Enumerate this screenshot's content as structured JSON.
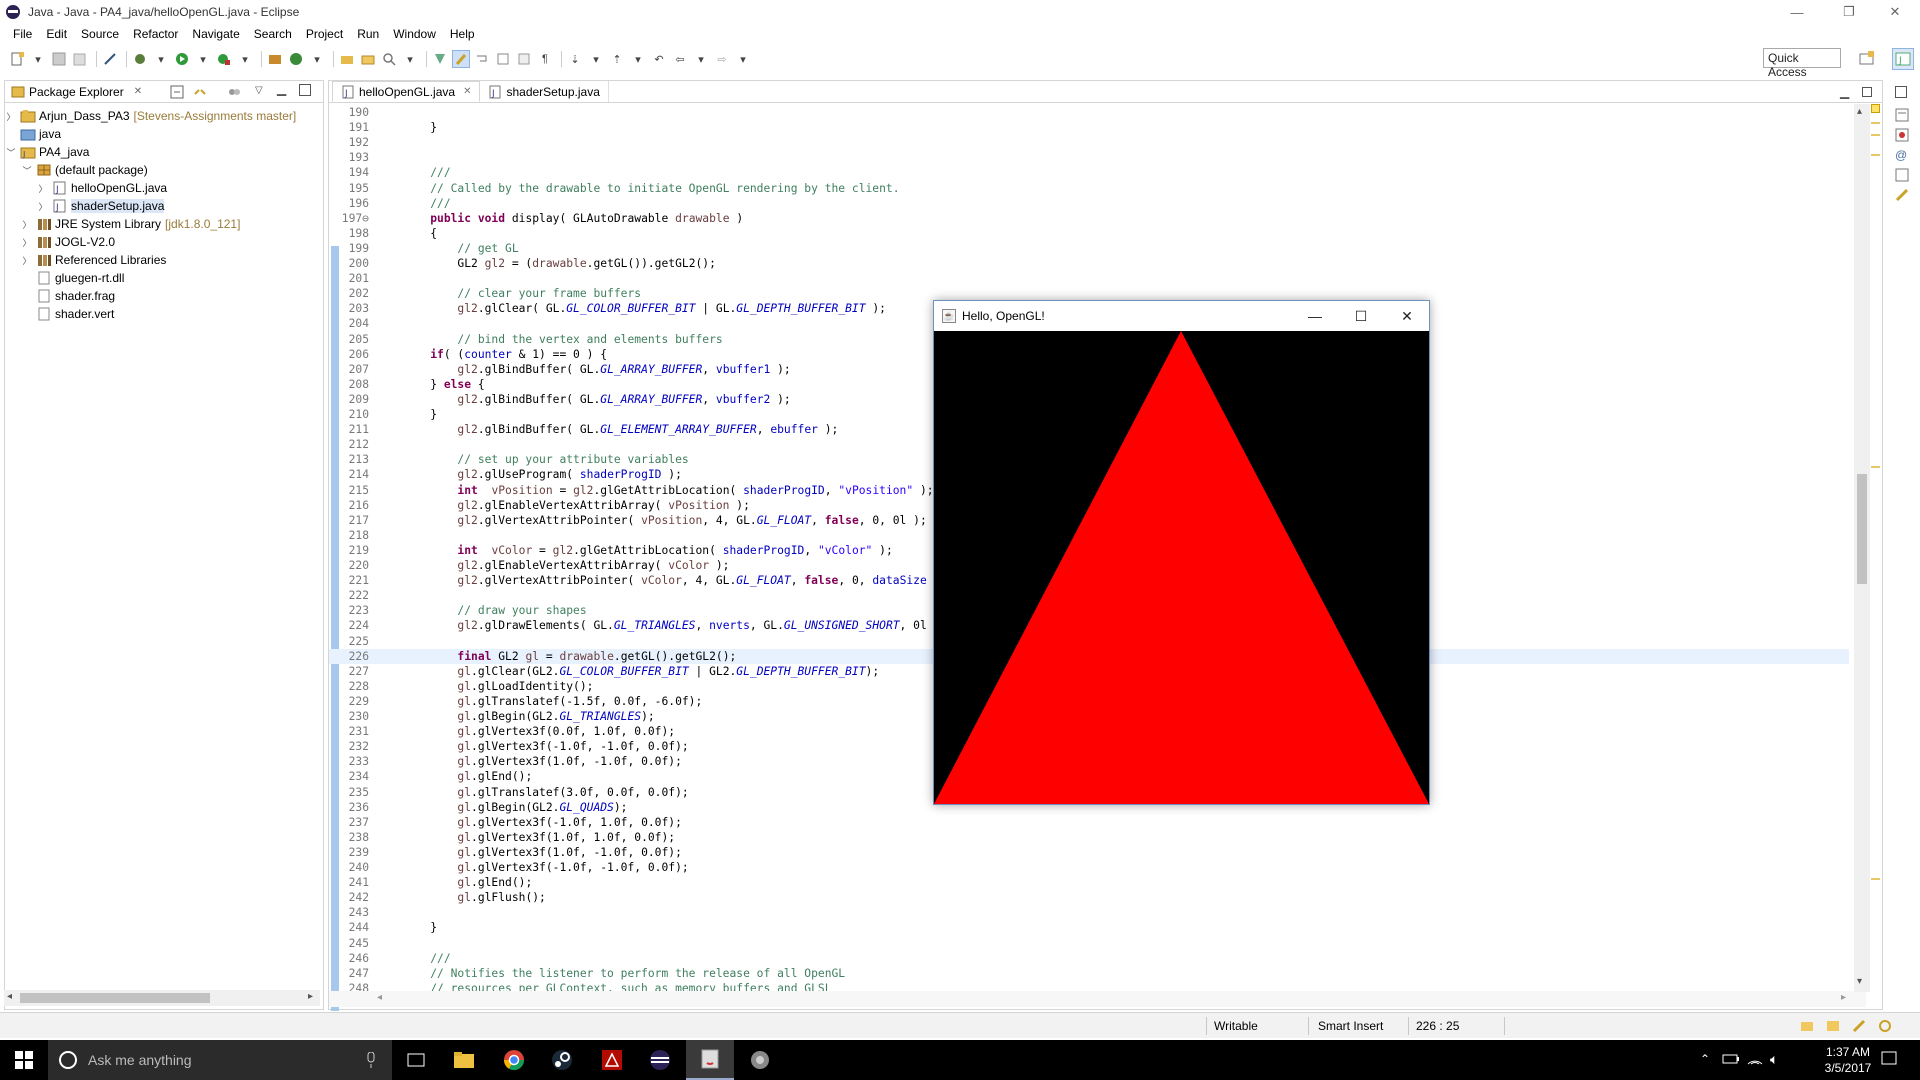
{
  "window": {
    "title": "Java - Java - PA4_java/helloOpenGL.java - Eclipse",
    "minimize": "—",
    "maximize": "❐",
    "close": "✕"
  },
  "menu": [
    "File",
    "Edit",
    "Source",
    "Refactor",
    "Navigate",
    "Search",
    "Project",
    "Run",
    "Window",
    "Help"
  ],
  "toolbar": {
    "quick_access": "Quick Access"
  },
  "package_explorer": {
    "title": "Package Explorer",
    "close": "✕",
    "items": [
      {
        "label": "Arjun_Dass_PA3",
        "decoration": "[Stevens-Assignments master]"
      },
      {
        "label": "java",
        "decoration": ""
      },
      {
        "label": "PA4_java",
        "decoration": ""
      },
      {
        "label": "(default package)",
        "decoration": ""
      },
      {
        "label": "helloOpenGL.java",
        "decoration": ""
      },
      {
        "label": "shaderSetup.java",
        "decoration": ""
      },
      {
        "label": "JRE System Library",
        "decoration": "[jdk1.8.0_121]"
      },
      {
        "label": "JOGL-V2.0",
        "decoration": ""
      },
      {
        "label": "Referenced Libraries",
        "decoration": ""
      },
      {
        "label": "gluegen-rt.dll",
        "decoration": ""
      },
      {
        "label": "shader.frag",
        "decoration": ""
      },
      {
        "label": "shader.vert",
        "decoration": ""
      }
    ]
  },
  "editor": {
    "tabs": [
      {
        "label": "helloOpenGL.java",
        "close": "✕"
      },
      {
        "label": "shaderSetup.java",
        "close": ""
      }
    ],
    "lines": [
      {
        "n": "190",
        "html": ""
      },
      {
        "n": "191",
        "html": "    }"
      },
      {
        "n": "192",
        "html": ""
      },
      {
        "n": "193",
        "html": ""
      },
      {
        "n": "194",
        "html": "    <span class='cm'>///</span>"
      },
      {
        "n": "195",
        "html": "    <span class='cm'>// Called by the drawable to initiate OpenGL rendering by the client.</span>"
      },
      {
        "n": "196",
        "html": "    <span class='cm'>///</span>"
      },
      {
        "n": "197⊖",
        "html": "    <span class='kw'>public void</span> display( GLAutoDrawable <span class='var'>drawable</span> )"
      },
      {
        "n": "198",
        "html": "    {"
      },
      {
        "n": "199",
        "html": "        <span class='cm'>// get GL</span>"
      },
      {
        "n": "200",
        "html": "        GL2 <span class='var'>gl2</span> = (<span class='var'>drawable</span>.getGL()).getGL2();"
      },
      {
        "n": "201",
        "html": ""
      },
      {
        "n": "202",
        "html": "        <span class='cm'>// clear your frame buffers</span>"
      },
      {
        "n": "203",
        "html": "        <span class='var'>gl2</span>.glClear( GL.<span class='fld'>GL_COLOR_BUFFER_BIT</span> | GL.<span class='fld'>GL_DEPTH_BUFFER_BIT</span> );"
      },
      {
        "n": "204",
        "html": ""
      },
      {
        "n": "205",
        "html": "        <span class='cm'>// bind the vertex and elements buffers</span>"
      },
      {
        "n": "206",
        "html": "    <span class='kw'>if</span>( (<span class='mem'>counter</span> &amp; 1) == 0 ) {"
      },
      {
        "n": "207",
        "html": "        <span class='var'>gl2</span>.glBindBuffer( GL.<span class='fld'>GL_ARRAY_BUFFER</span>, <span class='mem'>vbuffer1</span> );"
      },
      {
        "n": "208",
        "html": "    } <span class='kw'>else</span> {"
      },
      {
        "n": "209",
        "html": "        <span class='var'>gl2</span>.glBindBuffer( GL.<span class='fld'>GL_ARRAY_BUFFER</span>, <span class='mem'>vbuffer2</span> );"
      },
      {
        "n": "210",
        "html": "    }"
      },
      {
        "n": "211",
        "html": "        <span class='var'>gl2</span>.glBindBuffer( GL.<span class='fld'>GL_ELEMENT_ARRAY_BUFFER</span>, <span class='mem'>ebuffer</span> );"
      },
      {
        "n": "212",
        "html": ""
      },
      {
        "n": "213",
        "html": "        <span class='cm'>// set up your attribute variables</span>"
      },
      {
        "n": "214",
        "html": "        <span class='var'>gl2</span>.glUseProgram( <span class='mem'>shaderProgID</span> );"
      },
      {
        "n": "215",
        "html": "        <span class='kw'>int</span>  <span class='var'>vPosition</span> = <span class='var'>gl2</span>.glGetAttribLocation( <span class='mem'>shaderProgID</span>, <span class='st'>\"vPosition\"</span> );"
      },
      {
        "n": "216",
        "html": "        <span class='var'>gl2</span>.glEnableVertexAttribArray( <span class='var'>vPosition</span> );"
      },
      {
        "n": "217",
        "html": "        <span class='var'>gl2</span>.glVertexAttribPointer( <span class='var'>vPosition</span>, 4, GL.<span class='fld'>GL_FLOAT</span>, <span class='kw'>false</span>, 0, 0l );"
      },
      {
        "n": "218",
        "html": ""
      },
      {
        "n": "219",
        "html": "        <span class='kw'>int</span>  <span class='var'>vColor</span> = <span class='var'>gl2</span>.glGetAttribLocation( <span class='mem'>shaderProgID</span>, <span class='st'>\"vColor\"</span> );"
      },
      {
        "n": "220",
        "html": "        <span class='var'>gl2</span>.glEnableVertexAttribArray( <span class='var'>vColor</span> );"
      },
      {
        "n": "221",
        "html": "        <span class='var'>gl2</span>.glVertexAttribPointer( <span class='var'>vColor</span>, 4, GL.<span class='fld'>GL_FLOAT</span>, <span class='kw'>false</span>, 0, <span class='mem'>dataSize</span> );"
      },
      {
        "n": "222",
        "html": ""
      },
      {
        "n": "223",
        "html": "        <span class='cm'>// draw your shapes</span>"
      },
      {
        "n": "224",
        "html": "        <span class='var'>gl2</span>.glDrawElements( GL.<span class='fld'>GL_TRIANGLES</span>, <span class='mem'>nverts</span>, GL.<span class='fld'>GL_UNSIGNED_SHORT</span>, 0l );"
      },
      {
        "n": "225",
        "html": ""
      },
      {
        "n": "226",
        "html": "        <span class='kw'>final</span> GL2 <span class='var'>gl</span> = <span class='var'>drawable</span>.getGL().getGL2();"
      },
      {
        "n": "227",
        "html": "        <span class='var'>gl</span>.glClear(GL2.<span class='fld'>GL_COLOR_BUFFER_BIT</span> | GL2.<span class='fld'>GL_DEPTH_BUFFER_BIT</span>);"
      },
      {
        "n": "228",
        "html": "        <span class='var'>gl</span>.glLoadIdentity();"
      },
      {
        "n": "229",
        "html": "        <span class='var'>gl</span>.glTranslatef(-1.5f, 0.0f, -6.0f);"
      },
      {
        "n": "230",
        "html": "        <span class='var'>gl</span>.glBegin(GL2.<span class='fld'>GL_TRIANGLES</span>);"
      },
      {
        "n": "231",
        "html": "        <span class='var'>gl</span>.glVertex3f(0.0f, 1.0f, 0.0f);"
      },
      {
        "n": "232",
        "html": "        <span class='var'>gl</span>.glVertex3f(-1.0f, -1.0f, 0.0f);"
      },
      {
        "n": "233",
        "html": "        <span class='var'>gl</span>.glVertex3f(1.0f, -1.0f, 0.0f);"
      },
      {
        "n": "234",
        "html": "        <span class='var'>gl</span>.glEnd();"
      },
      {
        "n": "235",
        "html": "        <span class='var'>gl</span>.glTranslatef(3.0f, 0.0f, 0.0f);"
      },
      {
        "n": "236",
        "html": "        <span class='var'>gl</span>.glBegin(GL2.<span class='fld'>GL_QUADS</span>);"
      },
      {
        "n": "237",
        "html": "        <span class='var'>gl</span>.glVertex3f(-1.0f, 1.0f, 0.0f);"
      },
      {
        "n": "238",
        "html": "        <span class='var'>gl</span>.glVertex3f(1.0f, 1.0f, 0.0f);"
      },
      {
        "n": "239",
        "html": "        <span class='var'>gl</span>.glVertex3f(1.0f, -1.0f, 0.0f);"
      },
      {
        "n": "240",
        "html": "        <span class='var'>gl</span>.glVertex3f(-1.0f, -1.0f, 0.0f);"
      },
      {
        "n": "241",
        "html": "        <span class='var'>gl</span>.glEnd();"
      },
      {
        "n": "242",
        "html": "        <span class='var'>gl</span>.glFlush();"
      },
      {
        "n": "243",
        "html": ""
      },
      {
        "n": "244",
        "html": "    }"
      },
      {
        "n": "245",
        "html": ""
      },
      {
        "n": "246",
        "html": "    <span class='cm'>///</span>"
      },
      {
        "n": "247",
        "html": "    <span class='cm'>// Notifies the listener to perform the release of all OpenGL</span>"
      },
      {
        "n": "248",
        "html": "    <span class='cm'>// resources per GLContext, such as memory buffers and GLSL</span>"
      }
    ],
    "current_line": "226"
  },
  "status": {
    "writable": "Writable",
    "insert_mode": "Smart Insert",
    "position": "226 : 25"
  },
  "gl_window": {
    "title": "Hello, OpenGL!",
    "minimize": "—",
    "maximize": "☐",
    "close": "✕",
    "triangle_color": "#ff0000",
    "background_color": "#000000"
  },
  "taskbar": {
    "search_placeholder": "Ask me anything",
    "time": "1:37 AM",
    "date": "3/5/2017"
  }
}
